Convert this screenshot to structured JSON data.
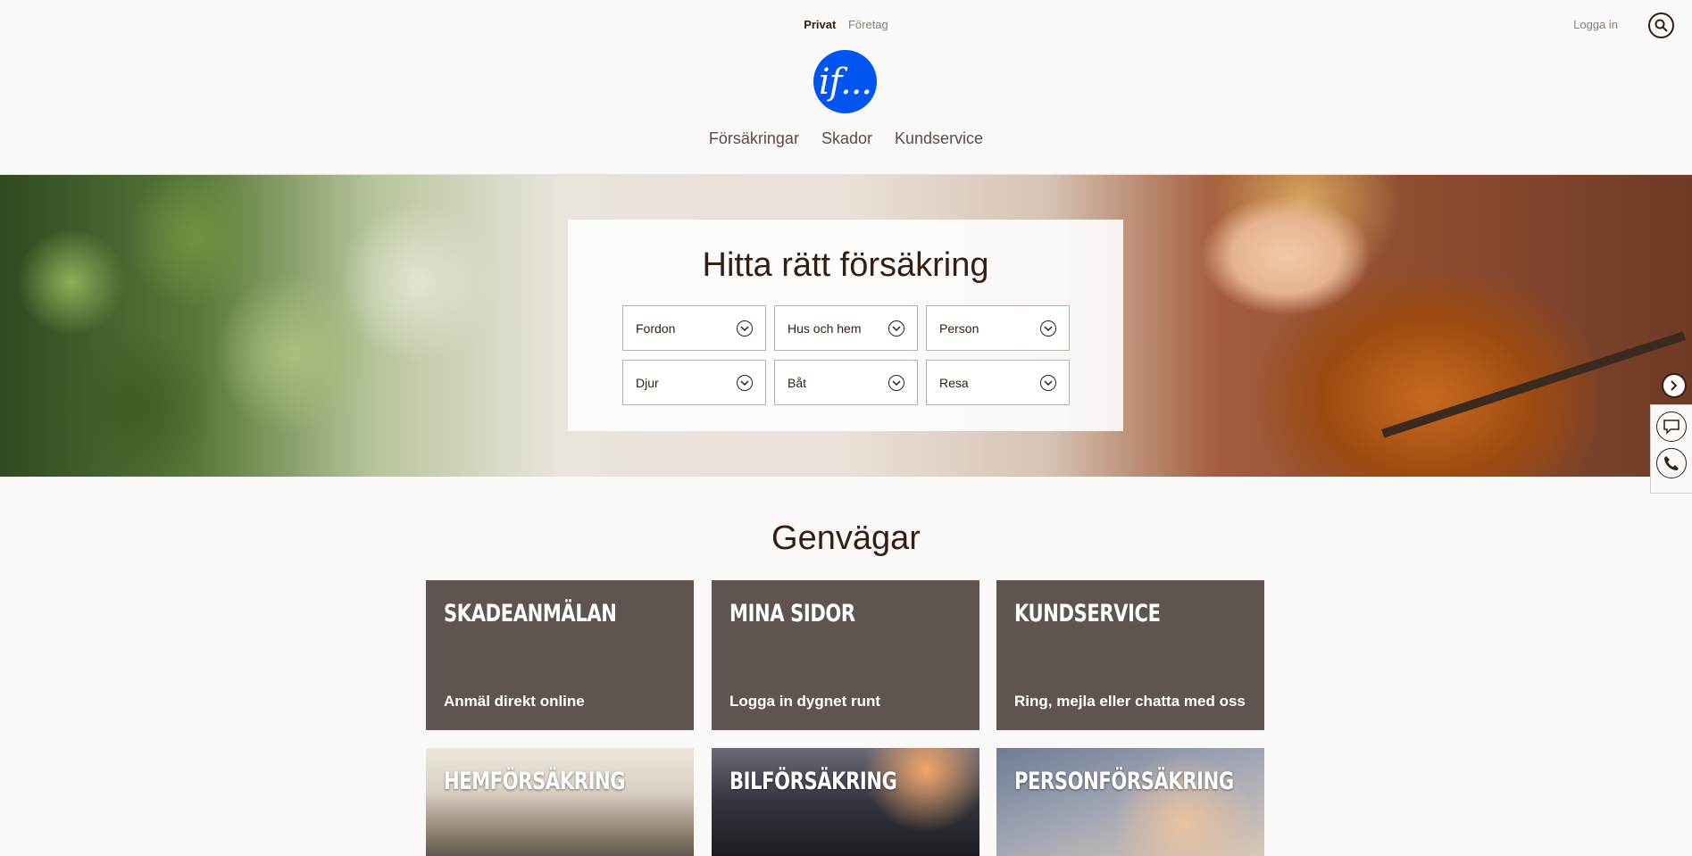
{
  "header": {
    "segments": [
      "Privat",
      "Företag"
    ],
    "login_label": "Logga in",
    "logo_text": "if...",
    "nav": [
      "Försäkringar",
      "Skador",
      "Kundservice"
    ]
  },
  "hero": {
    "title": "Hitta rätt försäkring",
    "categories": [
      "Fordon",
      "Hus och hem",
      "Person",
      "Djur",
      "Båt",
      "Resa"
    ]
  },
  "shortcuts": {
    "title": "Genvägar",
    "tiles": [
      {
        "title": "SKADEANMÄLAN",
        "subtitle": "Anmäl direkt online"
      },
      {
        "title": "MINA SIDOR",
        "subtitle": "Logga in dygnet runt"
      },
      {
        "title": "KUNDSERVICE",
        "subtitle": "Ring, mejla eller chatta med oss"
      }
    ],
    "image_tiles": [
      {
        "title": "HEMFÖRSÄKRING"
      },
      {
        "title": "BILFÖRSÄKRING"
      },
      {
        "title": "PERSONFÖRSÄKRING"
      }
    ]
  },
  "colors": {
    "brand_blue": "#0054f0",
    "tile_brown": "#5f5450",
    "text_dark": "#331e11",
    "background": "#faf9f7"
  },
  "icons": [
    "search-icon",
    "chevron-down-icon",
    "chevron-right-icon",
    "chat-icon",
    "phone-icon"
  ]
}
